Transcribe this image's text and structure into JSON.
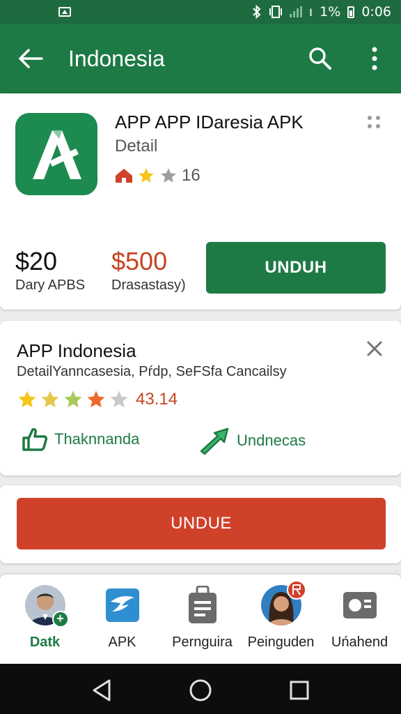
{
  "status_bar": {
    "battery_text": "1%",
    "time": "0:06",
    "signal_text": "ı"
  },
  "app_bar": {
    "title": "Indonesia"
  },
  "app_card": {
    "name": "APP APP IDaresia APK",
    "subtitle": "Detail",
    "rating_count": "16",
    "price_primary": "$20",
    "price_primary_label": "Dary APBS",
    "price_secondary": "$500",
    "price_secondary_label": "Drasastasy)",
    "download_label": "UNDUH"
  },
  "detail_card": {
    "title": "APP Indonesia",
    "subtitle": "DetailYanncasesia, Pŕdp, SeFSfa Cancailsy",
    "rating": "43.14",
    "action_left": "Thaknnanda",
    "action_right": "Undnecas"
  },
  "secondary_button": {
    "label": "UNDUE"
  },
  "bottom_nav": {
    "items": [
      {
        "label": "Datk",
        "icon": "person-avatar-icon"
      },
      {
        "label": "APK",
        "icon": "apk-store-icon"
      },
      {
        "label": "Pernguira",
        "icon": "clipboard-icon"
      },
      {
        "label": "Peinguden",
        "icon": "woman-avatar-icon"
      },
      {
        "label": "Uńahend",
        "icon": "id-card-icon"
      }
    ]
  },
  "colors": {
    "primary_green": "#1e7a45",
    "dark_green": "#1e6b3f",
    "accent_red": "#d0412a",
    "price_red": "#c4441f",
    "star_yellow": "#f5c518"
  }
}
